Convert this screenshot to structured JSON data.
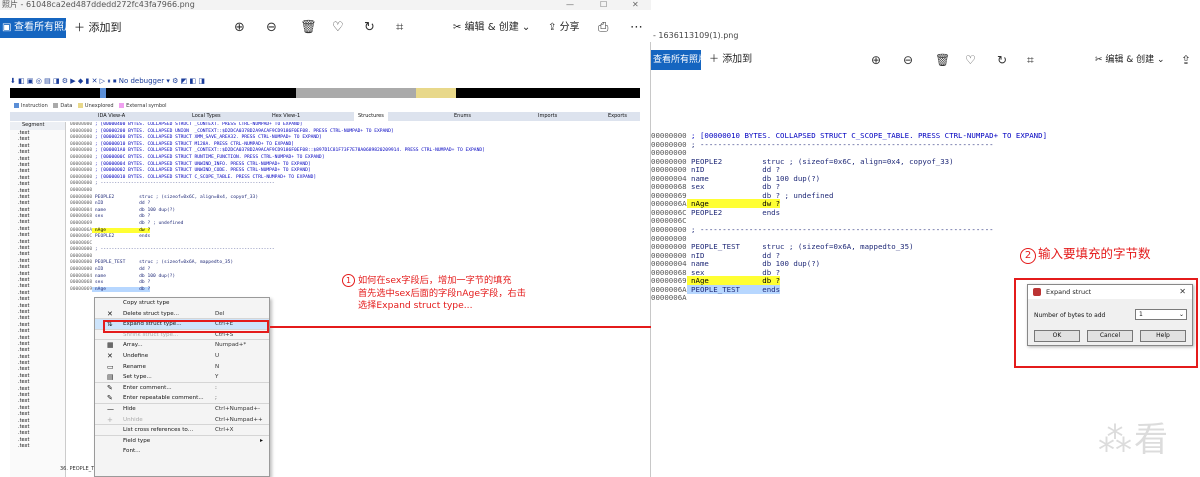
{
  "left_window": {
    "title": "照片 - 61048ca2ed487ddedd272fc43fa7966.png",
    "window_controls": [
      "—",
      "☐",
      "✕"
    ],
    "toolbar": {
      "view_all": "查看所有照片",
      "add_to": "添加到",
      "edit_create": "编辑 & 创建",
      "share": "分享"
    },
    "ida": {
      "toolbar_text": "No debugger",
      "legend": [
        "Instruction",
        "Data",
        "Unexplored",
        "External symbol"
      ],
      "tabs": [
        "IDA View-A",
        "Local Types",
        "Hex View-1",
        "Structures",
        "Enums",
        "Imports",
        "Exports"
      ],
      "segment_header": "Segment",
      "segments": [
        ".text",
        ".text",
        ".text",
        ".text",
        ".text",
        ".text",
        ".text",
        ".text",
        ".text",
        ".text",
        ".text",
        ".text",
        ".text",
        ".text",
        ".text",
        ".text",
        ".text",
        ".text",
        ".text",
        ".text",
        ".text",
        ".text",
        ".text",
        ".text",
        ".text",
        ".text",
        ".text",
        ".text",
        ".text",
        ".text",
        ".text",
        ".text",
        ".text",
        ".text",
        ".text",
        ".text",
        ".text",
        ".text",
        ".text",
        ".text",
        ".text",
        ".text",
        ".text",
        ".text",
        ".text",
        ".text",
        ".text",
        ".text",
        ".text",
        ".text"
      ],
      "code_lines": [
        {
          "addr": "00000000",
          "text": " ; [00000400 BYTES. COLLAPSED STRUCT _CONTEXT. PRESS CTRL-NUMPAD+ TO EXPAND]",
          "cls": "blue"
        },
        {
          "addr": "00000000",
          "text": " ; [00000200 BYTES. COLLAPSED UNION  _CONTEXT::$D2DCA0378D2A9ACAF9CD9186F0EF08. PRESS CTRL-NUMPAD+ TO EXPAND]",
          "cls": "blue"
        },
        {
          "addr": "00000000",
          "text": " ; [00000200 BYTES. COLLAPSED STRUCT XMM_SAVE_AREA32. PRESS CTRL-NUMPAD+ TO EXPAND]",
          "cls": "blue"
        },
        {
          "addr": "00000000",
          "text": " ; [00000010 BYTES. COLLAPSED STRUCT M128A. PRESS CTRL-NUMPAD+ TO EXPAND]",
          "cls": "blue"
        },
        {
          "addr": "00000000",
          "text": " ; [000001A0 BYTES. COLLAPSED STRUCT _CONTEXT::$D2DCA0378D2A9ACAF9CD9186F0EF08::$897D1C81F73F7E78A0689820209914. PRESS CTRL-NUMPAD+ TO EXPAND]",
          "cls": "blue"
        },
        {
          "addr": "00000000",
          "text": " ; [0000000C BYTES. COLLAPSED STRUCT RUNTIME_FUNCTION. PRESS CTRL-NUMPAD+ TO EXPAND]",
          "cls": "blue"
        },
        {
          "addr": "00000000",
          "text": " ; [00000004 BYTES. COLLAPSED STRUCT UNWIND_INFO. PRESS CTRL-NUMPAD+ TO EXPAND]",
          "cls": "blue"
        },
        {
          "addr": "00000000",
          "text": " ; [00000002 BYTES. COLLAPSED STRUCT UNWIND_CODE. PRESS CTRL-NUMPAD+ TO EXPAND]",
          "cls": "blue"
        },
        {
          "addr": "00000000",
          "text": " ; [00000010 BYTES. COLLAPSED STRUCT C_SCOPE_TABLE. PRESS CTRL-NUMPAD+ TO EXPAND]",
          "cls": "blue"
        },
        {
          "addr": "00000000",
          "text": " ; ---------------------------------------------------------------",
          "cls": ""
        },
        {
          "addr": "00000000",
          "text": "",
          "cls": ""
        },
        {
          "addr": "00000000",
          "text": " PEOPLE2         struc ; (sizeof=0x6C, align=0x4, copyof_33)",
          "cls": ""
        },
        {
          "addr": "00000000",
          "text": " nID             dd ?",
          "cls": ""
        },
        {
          "addr": "00000004",
          "text": " name            db 100 dup(?)",
          "cls": ""
        },
        {
          "addr": "00000068",
          "text": " sex             db ?",
          "cls": ""
        },
        {
          "addr": "00000069",
          "text": "                 db ? ; undefined",
          "cls": ""
        },
        {
          "addr": "0000006A",
          "text": " nAge            dw ?",
          "cls": "hl"
        },
        {
          "addr": "0000006C",
          "text": " PEOPLE2         ends",
          "cls": ""
        },
        {
          "addr": "0000006C",
          "text": "",
          "cls": ""
        },
        {
          "addr": "00000000",
          "text": " ; ---------------------------------------------------------------",
          "cls": ""
        },
        {
          "addr": "00000000",
          "text": "",
          "cls": ""
        },
        {
          "addr": "00000000",
          "text": " PEOPLE_TEST     struc ; (sizeof=0x6A, mappedto_35)",
          "cls": ""
        },
        {
          "addr": "00000000",
          "text": " nID             dd ?",
          "cls": ""
        },
        {
          "addr": "00000004",
          "text": " name            db 100 dup(?)",
          "cls": ""
        },
        {
          "addr": "00000068",
          "text": " sex             db ?",
          "cls": ""
        },
        {
          "addr": "00000069",
          "text": " nAge            db ?",
          "cls": "sel"
        }
      ],
      "bottom_text": "36. PEOPLE_T"
    },
    "context_menu": [
      {
        "icon": "",
        "label": "Copy struct type",
        "key": "",
        "state": "normal"
      },
      {
        "icon": "✕",
        "label": "Delete struct type...",
        "key": "Del",
        "state": "sep"
      },
      {
        "icon": "⇅",
        "label": "Expand struct type...",
        "key": "Ctrl+E",
        "state": "selected"
      },
      {
        "icon": "",
        "label": "Shrink struct type...",
        "key": "Ctrl+S",
        "state": "disabled-sep"
      },
      {
        "icon": "▦",
        "label": "Array...",
        "key": "Numpad+*",
        "state": "normal"
      },
      {
        "icon": "✕",
        "label": "Undefine",
        "key": "U",
        "state": "normal"
      },
      {
        "icon": "▭",
        "label": "Rename",
        "key": "N",
        "state": "normal"
      },
      {
        "icon": "▤",
        "label": "Set type...",
        "key": "Y",
        "state": "sep"
      },
      {
        "icon": "✎",
        "label": "Enter comment...",
        "key": ":",
        "state": "normal"
      },
      {
        "icon": "✎",
        "label": "Enter repeatable comment...",
        "key": ";",
        "state": "sep"
      },
      {
        "icon": "—",
        "label": "Hide",
        "key": "Ctrl+Numpad+-",
        "state": "normal"
      },
      {
        "icon": "+",
        "label": "Unhide",
        "key": "Ctrl+Numpad++",
        "state": "disabled-sep"
      },
      {
        "icon": "",
        "label": "List cross references to...",
        "key": "Ctrl+X",
        "state": "sep"
      },
      {
        "icon": "",
        "label": "Field type",
        "key": "",
        "state": "submenu"
      },
      {
        "icon": "",
        "label": "Font...",
        "key": "",
        "state": "normal"
      }
    ],
    "note1": {
      "number": "1",
      "lines": [
        "如何在sex字段后，增加一字节的填充",
        "首先选中sex后面的字段nAge字段，右击",
        "选择Expand struct type..."
      ]
    }
  },
  "right_window": {
    "title": "- 1636113109(1).png",
    "toolbar": {
      "view_all": "查看所有照片",
      "add_to": "添加到",
      "edit_create": "编辑 & 创建"
    },
    "code_lines": [
      {
        "addr": "00000000",
        "text": " ; [00000010 BYTES. COLLAPSED STRUCT C_SCOPE_TABLE. PRESS CTRL-NUMPAD+ TO EXPAND]",
        "cls": "blue"
      },
      {
        "addr": "00000000",
        "text": " ; ------------------------------------------------------------------",
        "cls": ""
      },
      {
        "addr": "00000000",
        "text": "",
        "cls": ""
      },
      {
        "addr": "00000000",
        "text": " PEOPLE2         struc ; (sizeof=0x6C, align=0x4, copyof_33)",
        "cls": ""
      },
      {
        "addr": "00000000",
        "text": " nID             dd ?",
        "cls": ""
      },
      {
        "addr": "00000004",
        "text": " name            db 100 dup(?)",
        "cls": ""
      },
      {
        "addr": "00000068",
        "text": " sex             db ?",
        "cls": ""
      },
      {
        "addr": "00000069",
        "text": "                 db ? ; undefined",
        "cls": ""
      },
      {
        "addr": "0000006A",
        "text": " nAge            dw ?",
        "cls": "hl"
      },
      {
        "addr": "0000006C",
        "text": " PEOPLE2         ends",
        "cls": ""
      },
      {
        "addr": "0000006C",
        "text": "",
        "cls": ""
      },
      {
        "addr": "00000000",
        "text": " ; ------------------------------------------------------------------",
        "cls": ""
      },
      {
        "addr": "00000000",
        "text": "",
        "cls": ""
      },
      {
        "addr": "00000000",
        "text": " PEOPLE_TEST     struc ; (sizeof=0x6A, mappedto_35)",
        "cls": ""
      },
      {
        "addr": "00000000",
        "text": " nID             dd ?",
        "cls": ""
      },
      {
        "addr": "00000004",
        "text": " name            db 100 dup(?)",
        "cls": ""
      },
      {
        "addr": "00000068",
        "text": " sex             db ?",
        "cls": ""
      },
      {
        "addr": "00000069",
        "text": " nAge            db ?",
        "cls": "hl"
      },
      {
        "addr": "0000006A",
        "text": " PEOPLE_TEST     ends",
        "cls": "sel"
      },
      {
        "addr": "0000006A",
        "text": "",
        "cls": ""
      }
    ],
    "note2": {
      "number": "2",
      "text": "输入要填充的字节数"
    },
    "dialog": {
      "title": "Expand struct",
      "label": "Number of bytes to add",
      "value": "1",
      "ok": "OK",
      "cancel": "Cancel",
      "help": "Help"
    }
  },
  "watermark": "看",
  "colors": {
    "accent": "#1565c0",
    "annotation": "#e41b1b",
    "highlight": "#ffff33"
  }
}
